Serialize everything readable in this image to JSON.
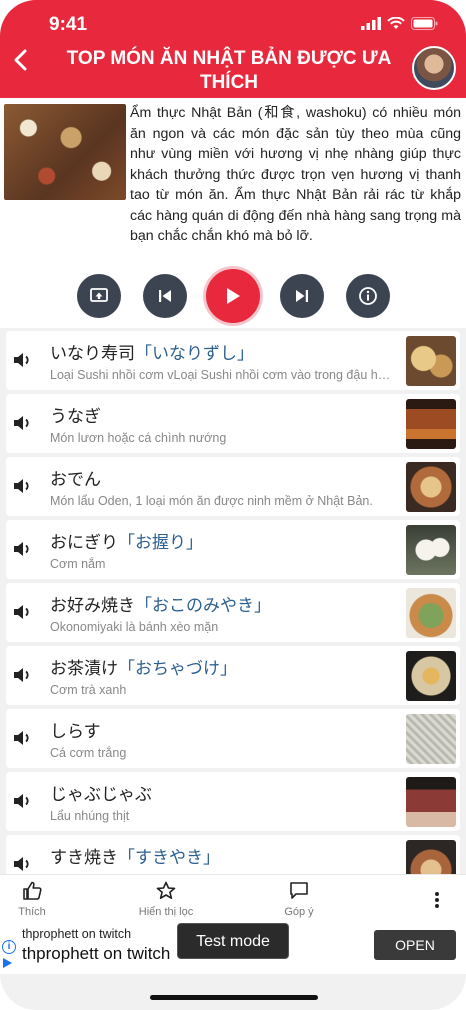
{
  "status": {
    "time": "9:41"
  },
  "header": {
    "title": "TOP MÓN ĂN NHẬT BẢN ĐƯỢC ƯA THÍCH"
  },
  "intro": {
    "text": "Ẩm thực Nhật Bản (和食, washoku) có nhiều món ăn ngon và các món đặc sản tùy theo mùa cũng như vùng miền với hương vị nhẹ nhàng giúp thực khách thưởng thức được trọn vẹn hương vị thanh tao từ món ăn. Ẩm thực Nhật Bản rải rác từ khắp các hàng quán di động đến nhà hàng sang trọng mà bạn chắc chắn khó mà bỏ lỡ."
  },
  "controls": {
    "icons": [
      "screen-cast-icon",
      "previous-icon",
      "play-icon",
      "next-icon",
      "info-icon"
    ]
  },
  "items": [
    {
      "jp": "いなり寿司",
      "reading": "「いなりずし」",
      "vi": "Loại Sushi nhồi cơm vLoại Sushi nhồi cơm vào trong đậu hũ chiên",
      "thumb": "#c99a55"
    },
    {
      "jp": "うなぎ",
      "reading": "",
      "vi": "Món lươn hoặc cá chình nướng",
      "thumb": "#9c4b23"
    },
    {
      "jp": "おでん",
      "reading": "",
      "vi": "Món lẩu Oden, 1 loại món ăn được ninh mềm ở Nhật Bản.",
      "thumb": "#b06a3b"
    },
    {
      "jp": "おにぎり",
      "reading": "「お握り」",
      "vi": "Cơm nắm",
      "thumb": "#e6e2d6"
    },
    {
      "jp": "お好み焼き",
      "reading": "「おこのみやき」",
      "vi": "Okonomiyaki là bánh xèo mặn",
      "thumb": "#7fa35a"
    },
    {
      "jp": "お茶漬け",
      "reading": "「おちゃづけ」",
      "vi": "Cơm trà xanh",
      "thumb": "#d7c7a2"
    },
    {
      "jp": "しらす",
      "reading": "",
      "vi": "Cá cơm trắng",
      "thumb": "#cfcfc8"
    },
    {
      "jp": "じゃぶじゃぶ",
      "reading": "",
      "vi": "Lẩu nhúng thịt",
      "thumb": "#8c3a35"
    },
    {
      "jp": "すき焼き",
      "reading": "「すきやき」",
      "vi": "",
      "thumb": "#a8643a"
    }
  ],
  "tabs": {
    "like": "Thích",
    "filter": "Hiển thị lọc",
    "feedback": "Góp ý"
  },
  "ad": {
    "small": "thprophett on twitch",
    "big": "thprophett on twitch",
    "open": "OPEN"
  },
  "toast": "Test mode",
  "colors": {
    "accent": "#e8293d",
    "control": "#3c4452",
    "reading": "#2d5f8f"
  }
}
